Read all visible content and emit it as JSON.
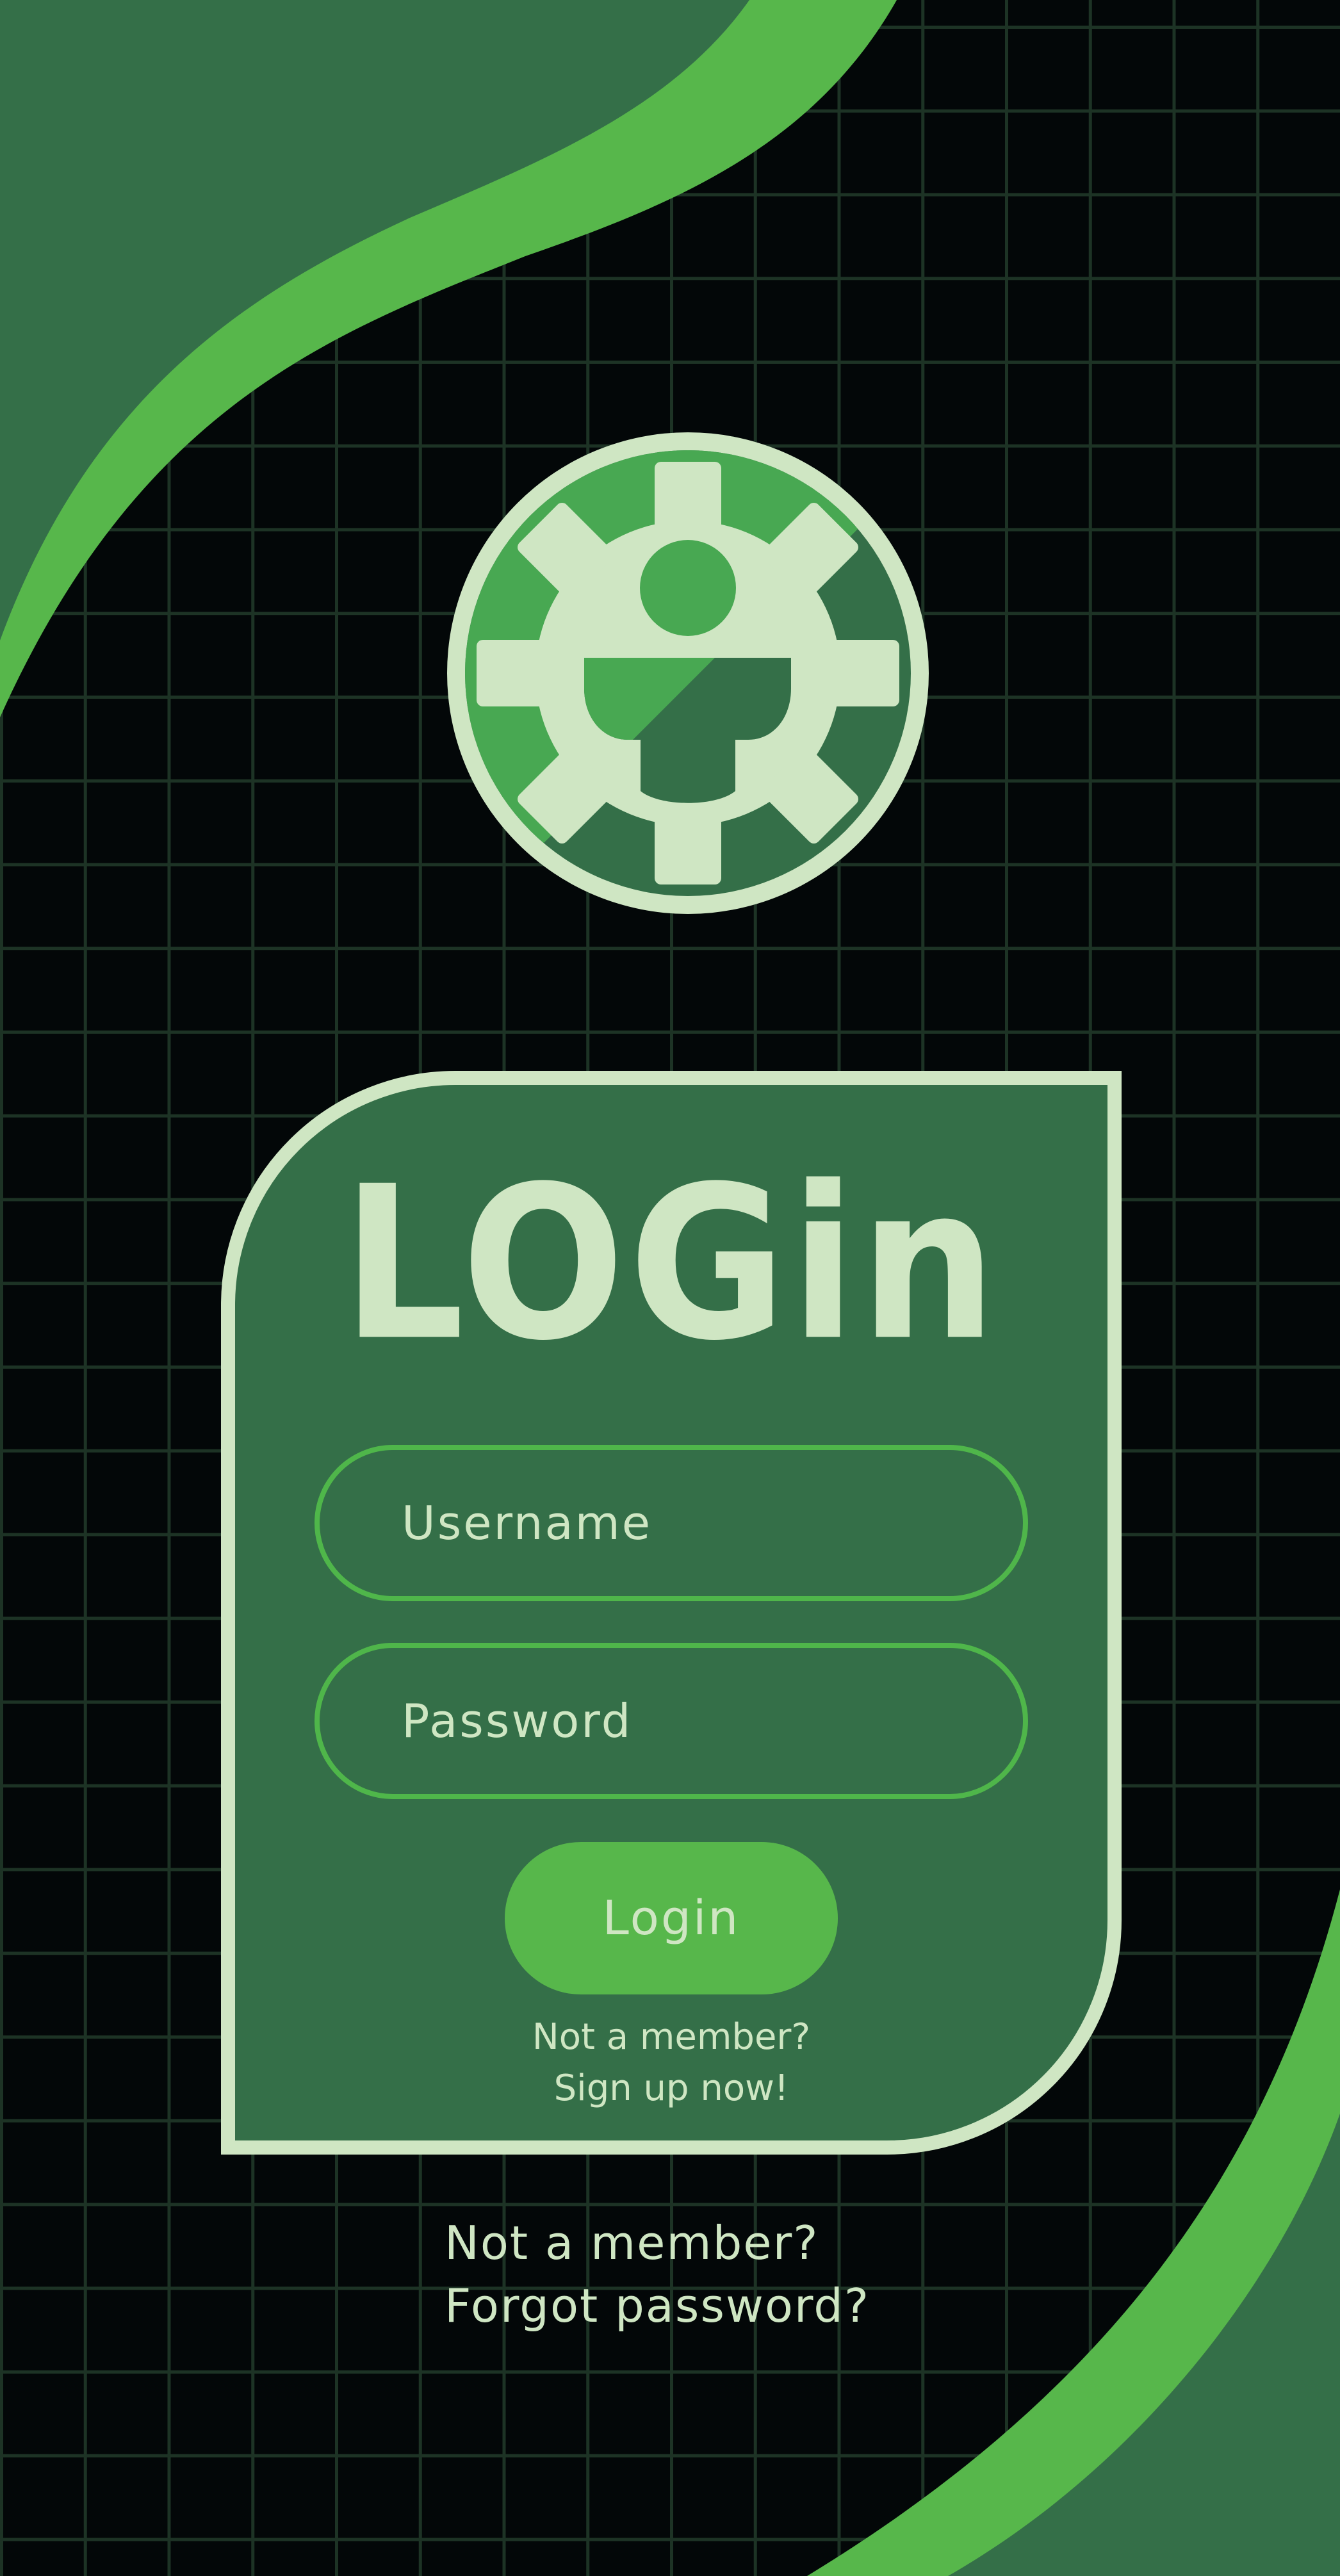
{
  "theme": {
    "background": "#030708",
    "grid_line": "#1d3325",
    "dark_green": "#346f48",
    "bright_green": "#57b74b",
    "pale_green": "#cfe6c3"
  },
  "logo": {
    "icon": "gear-person-icon"
  },
  "card": {
    "title": "LOGin",
    "username_placeholder": "Username",
    "password_placeholder": "Password",
    "login_button_label": "Login",
    "signup_prompt": "Not a member?",
    "signup_link": "Sign up now!"
  },
  "footer": {
    "member_link": "Not a member?",
    "forgot_password_link": "Forgot password?"
  }
}
